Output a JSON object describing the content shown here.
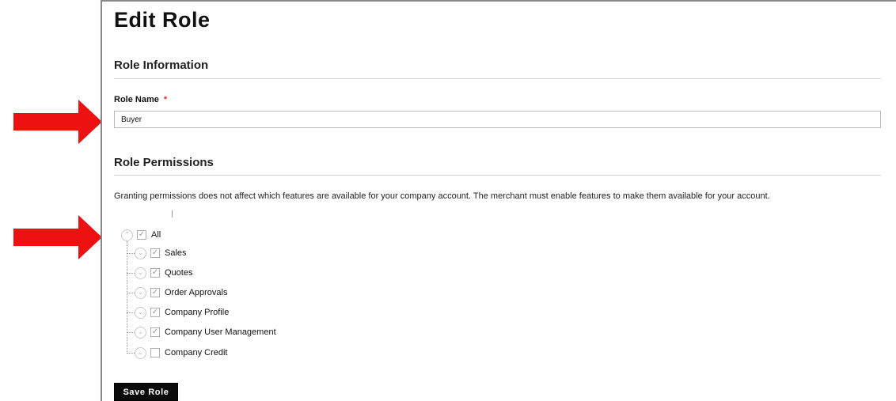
{
  "page": {
    "title": "Edit Role"
  },
  "role_info": {
    "heading": "Role Information",
    "role_name_label": "Role Name",
    "required_mark": "*",
    "role_name_value": "Buyer"
  },
  "role_permissions": {
    "heading": "Role Permissions",
    "notice": "Granting permissions does not affect which features are available for your company account. The merchant must enable features to make them available for your account.",
    "tree": [
      {
        "label": "All",
        "checked": true,
        "expanded": true
      },
      {
        "label": "Sales",
        "checked": true,
        "expanded": false
      },
      {
        "label": "Quotes",
        "checked": true,
        "expanded": false
      },
      {
        "label": "Order Approvals",
        "checked": true,
        "expanded": false
      },
      {
        "label": "Company Profile",
        "checked": true,
        "expanded": false
      },
      {
        "label": "Company User Management",
        "checked": true,
        "expanded": false
      },
      {
        "label": "Company Credit",
        "checked": false,
        "expanded": false
      }
    ]
  },
  "actions": {
    "save_label": "Save Role"
  },
  "icons": {
    "toggle_expanded": "chevron-up-icon",
    "toggle_collapsed": "chevron-down-icon",
    "check": "checkmark-icon",
    "annotation": "red-arrow-icon"
  },
  "colors": {
    "accent_required": "#e02b27",
    "button_bg": "#0b0b0b",
    "annotation_arrow": "#ee1111"
  }
}
